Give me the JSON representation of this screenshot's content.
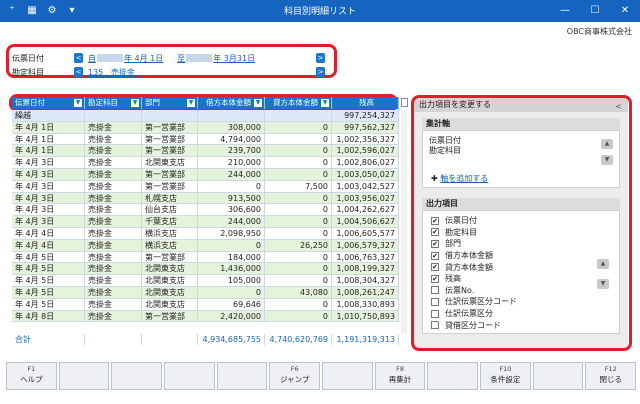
{
  "titlebar": {
    "title": "科目別明細リスト",
    "icons": [
      "user-add-icon",
      "excel-icon",
      "settings-icon",
      "menu-down-icon"
    ],
    "minimize": "—",
    "maximize": "☐",
    "close": "✕"
  },
  "company": "OBC商事株式会社",
  "filters": {
    "date": {
      "label": "伝票日付",
      "from_prefix": "自",
      "from_rest": "年 4月 1日",
      "to_prefix": "至",
      "to_rest": "年 3月31日"
    },
    "account": {
      "label": "勘定科目",
      "code": "135",
      "name": "売掛金"
    }
  },
  "columns": [
    "伝票日付",
    "勘定科目",
    "部門",
    "借方本体金額",
    "貸方本体金額",
    "残高"
  ],
  "carry_label": "繰越",
  "carry_balance": "997,254,327",
  "rows": [
    {
      "date": "年 4月 1日",
      "acct": "売掛金",
      "dept": "第一営業部",
      "debit": "308,000",
      "credit": "0",
      "bal": "997,562,327"
    },
    {
      "date": "年 4月 1日",
      "acct": "売掛金",
      "dept": "第一営業部",
      "debit": "4,794,000",
      "credit": "0",
      "bal": "1,002,356,327"
    },
    {
      "date": "年 4月 1日",
      "acct": "売掛金",
      "dept": "第一営業部",
      "debit": "239,700",
      "credit": "0",
      "bal": "1,002,596,027"
    },
    {
      "date": "年 4月 3日",
      "acct": "売掛金",
      "dept": "北関東支店",
      "debit": "210,000",
      "credit": "0",
      "bal": "1,002,806,027"
    },
    {
      "date": "年 4月 3日",
      "acct": "売掛金",
      "dept": "第一営業部",
      "debit": "244,000",
      "credit": "0",
      "bal": "1,003,050,027"
    },
    {
      "date": "年 4月 3日",
      "acct": "売掛金",
      "dept": "第一営業部",
      "debit": "0",
      "credit": "7,500",
      "bal": "1,003,042,527"
    },
    {
      "date": "年 4月 3日",
      "acct": "売掛金",
      "dept": "札幌支店",
      "debit": "913,500",
      "credit": "0",
      "bal": "1,003,956,027"
    },
    {
      "date": "年 4月 3日",
      "acct": "売掛金",
      "dept": "仙台支店",
      "debit": "306,600",
      "credit": "0",
      "bal": "1,004,262,627"
    },
    {
      "date": "年 4月 3日",
      "acct": "売掛金",
      "dept": "千葉支店",
      "debit": "244,000",
      "credit": "0",
      "bal": "1,004,506,627"
    },
    {
      "date": "年 4月 4日",
      "acct": "売掛金",
      "dept": "横浜支店",
      "debit": "2,098,950",
      "credit": "0",
      "bal": "1,006,605,577"
    },
    {
      "date": "年 4月 4日",
      "acct": "売掛金",
      "dept": "横浜支店",
      "debit": "0",
      "credit": "26,250",
      "bal": "1,006,579,327"
    },
    {
      "date": "年 4月 5日",
      "acct": "売掛金",
      "dept": "第一営業部",
      "debit": "184,000",
      "credit": "0",
      "bal": "1,006,763,327"
    },
    {
      "date": "年 4月 5日",
      "acct": "売掛金",
      "dept": "北関東支店",
      "debit": "1,436,000",
      "credit": "0",
      "bal": "1,008,199,327"
    },
    {
      "date": "年 4月 5日",
      "acct": "売掛金",
      "dept": "北関東支店",
      "debit": "105,000",
      "credit": "0",
      "bal": "1,008,304,327"
    },
    {
      "date": "年 4月 5日",
      "acct": "売掛金",
      "dept": "北関東支店",
      "debit": "0",
      "credit": "43,080",
      "bal": "1,008,261,247"
    },
    {
      "date": "年 4月 5日",
      "acct": "売掛金",
      "dept": "北関東支店",
      "debit": "69,646",
      "credit": "0",
      "bal": "1,008,330,893"
    },
    {
      "date": "年 4月 8日",
      "acct": "売掛金",
      "dept": "第一営業部",
      "debit": "2,420,000",
      "credit": "0",
      "bal": "1,010,750,893"
    }
  ],
  "totals": {
    "label": "合計",
    "debit": "4,934,685,755",
    "credit": "4,740,620,769",
    "bal": "1,191,319,313"
  },
  "panel": {
    "title": "出力項目を変更する",
    "close": "<",
    "axis_title": "集計軸",
    "axis_items": [
      "伝票日付",
      "勘定科目"
    ],
    "add_axis": "軸を追加する",
    "output_title": "出力項目",
    "output_items": [
      {
        "label": "伝票日付",
        "checked": true
      },
      {
        "label": "勘定科目",
        "checked": true
      },
      {
        "label": "部門",
        "checked": true
      },
      {
        "label": "借方本体金額",
        "checked": true
      },
      {
        "label": "貸方本体金額",
        "checked": true
      },
      {
        "label": "残高",
        "checked": true
      },
      {
        "label": "伝票No.",
        "checked": false
      },
      {
        "label": "仕訳伝票区分コード",
        "checked": false
      },
      {
        "label": "仕訳伝票区分",
        "checked": false
      },
      {
        "label": "貸借区分コード",
        "checked": false
      }
    ]
  },
  "fkeys": [
    {
      "k": "F1",
      "l": "ヘルプ"
    },
    {
      "k": "",
      "l": ""
    },
    {
      "k": "",
      "l": ""
    },
    {
      "k": "",
      "l": ""
    },
    {
      "k": "",
      "l": ""
    },
    {
      "k": "F6",
      "l": "ジャンプ"
    },
    {
      "k": "",
      "l": ""
    },
    {
      "k": "F8",
      "l": "再集計"
    },
    {
      "k": "",
      "l": ""
    },
    {
      "k": "F10",
      "l": "条件設定"
    },
    {
      "k": "",
      "l": ""
    },
    {
      "k": "F12",
      "l": "閉じる"
    }
  ],
  "colors": {
    "titlebar": "#1565c0",
    "header": "#1e73c9",
    "highlight": "#e31c2a",
    "row_alt": "#e6f3dc"
  }
}
